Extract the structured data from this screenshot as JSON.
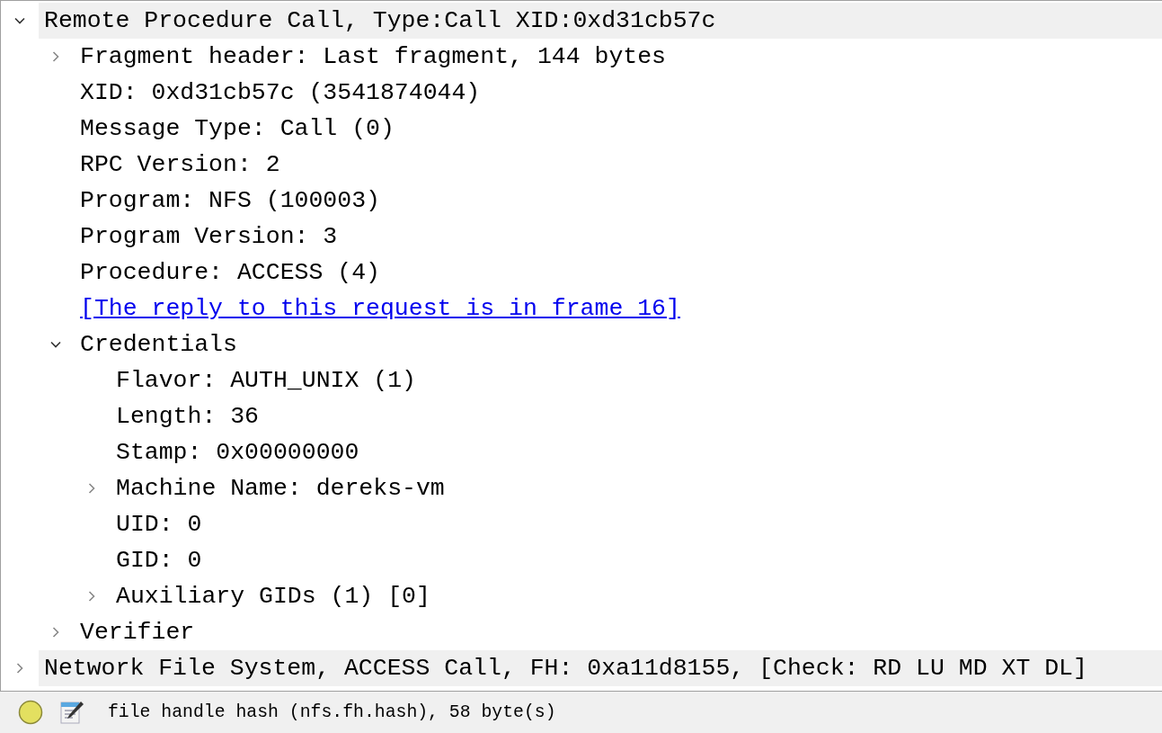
{
  "tree": [
    {
      "label": "Remote Procedure Call, Type:Call XID:0xd31cb57c",
      "kind": "field",
      "expanded": true,
      "children": [
        {
          "label": "Fragment header: Last fragment, 144 bytes",
          "kind": "field",
          "expanded": false
        },
        {
          "label": "XID: 0xd31cb57c (3541874044)",
          "kind": "field"
        },
        {
          "label": "Message Type: Call (0)",
          "kind": "field"
        },
        {
          "label": "RPC Version: 2",
          "kind": "field"
        },
        {
          "label": "Program: NFS (100003)",
          "kind": "field"
        },
        {
          "label": "Program Version: 3",
          "kind": "field"
        },
        {
          "label": "Procedure: ACCESS (4)",
          "kind": "field"
        },
        {
          "label": "[The reply to this request is in frame 16]",
          "kind": "link"
        },
        {
          "label": "Credentials",
          "kind": "field",
          "expanded": true,
          "children": [
            {
              "label": "Flavor: AUTH_UNIX (1)",
              "kind": "field"
            },
            {
              "label": "Length: 36",
              "kind": "field"
            },
            {
              "label": "Stamp: 0x00000000",
              "kind": "field"
            },
            {
              "label": "Machine Name: dereks-vm",
              "kind": "field",
              "expanded": false
            },
            {
              "label": "UID: 0",
              "kind": "field"
            },
            {
              "label": "GID: 0",
              "kind": "field"
            },
            {
              "label": "Auxiliary GIDs (1) [0]",
              "kind": "field",
              "expanded": false
            }
          ]
        },
        {
          "label": "Verifier",
          "kind": "field",
          "expanded": false
        }
      ]
    },
    {
      "label": "Network File System, ACCESS Call, FH: 0xa11d8155, [Check: RD LU MD XT DL]",
      "kind": "field",
      "expanded": false
    }
  ],
  "status_bar": {
    "text": "file handle hash (nfs.fh.hash), 58 byte(s)"
  }
}
